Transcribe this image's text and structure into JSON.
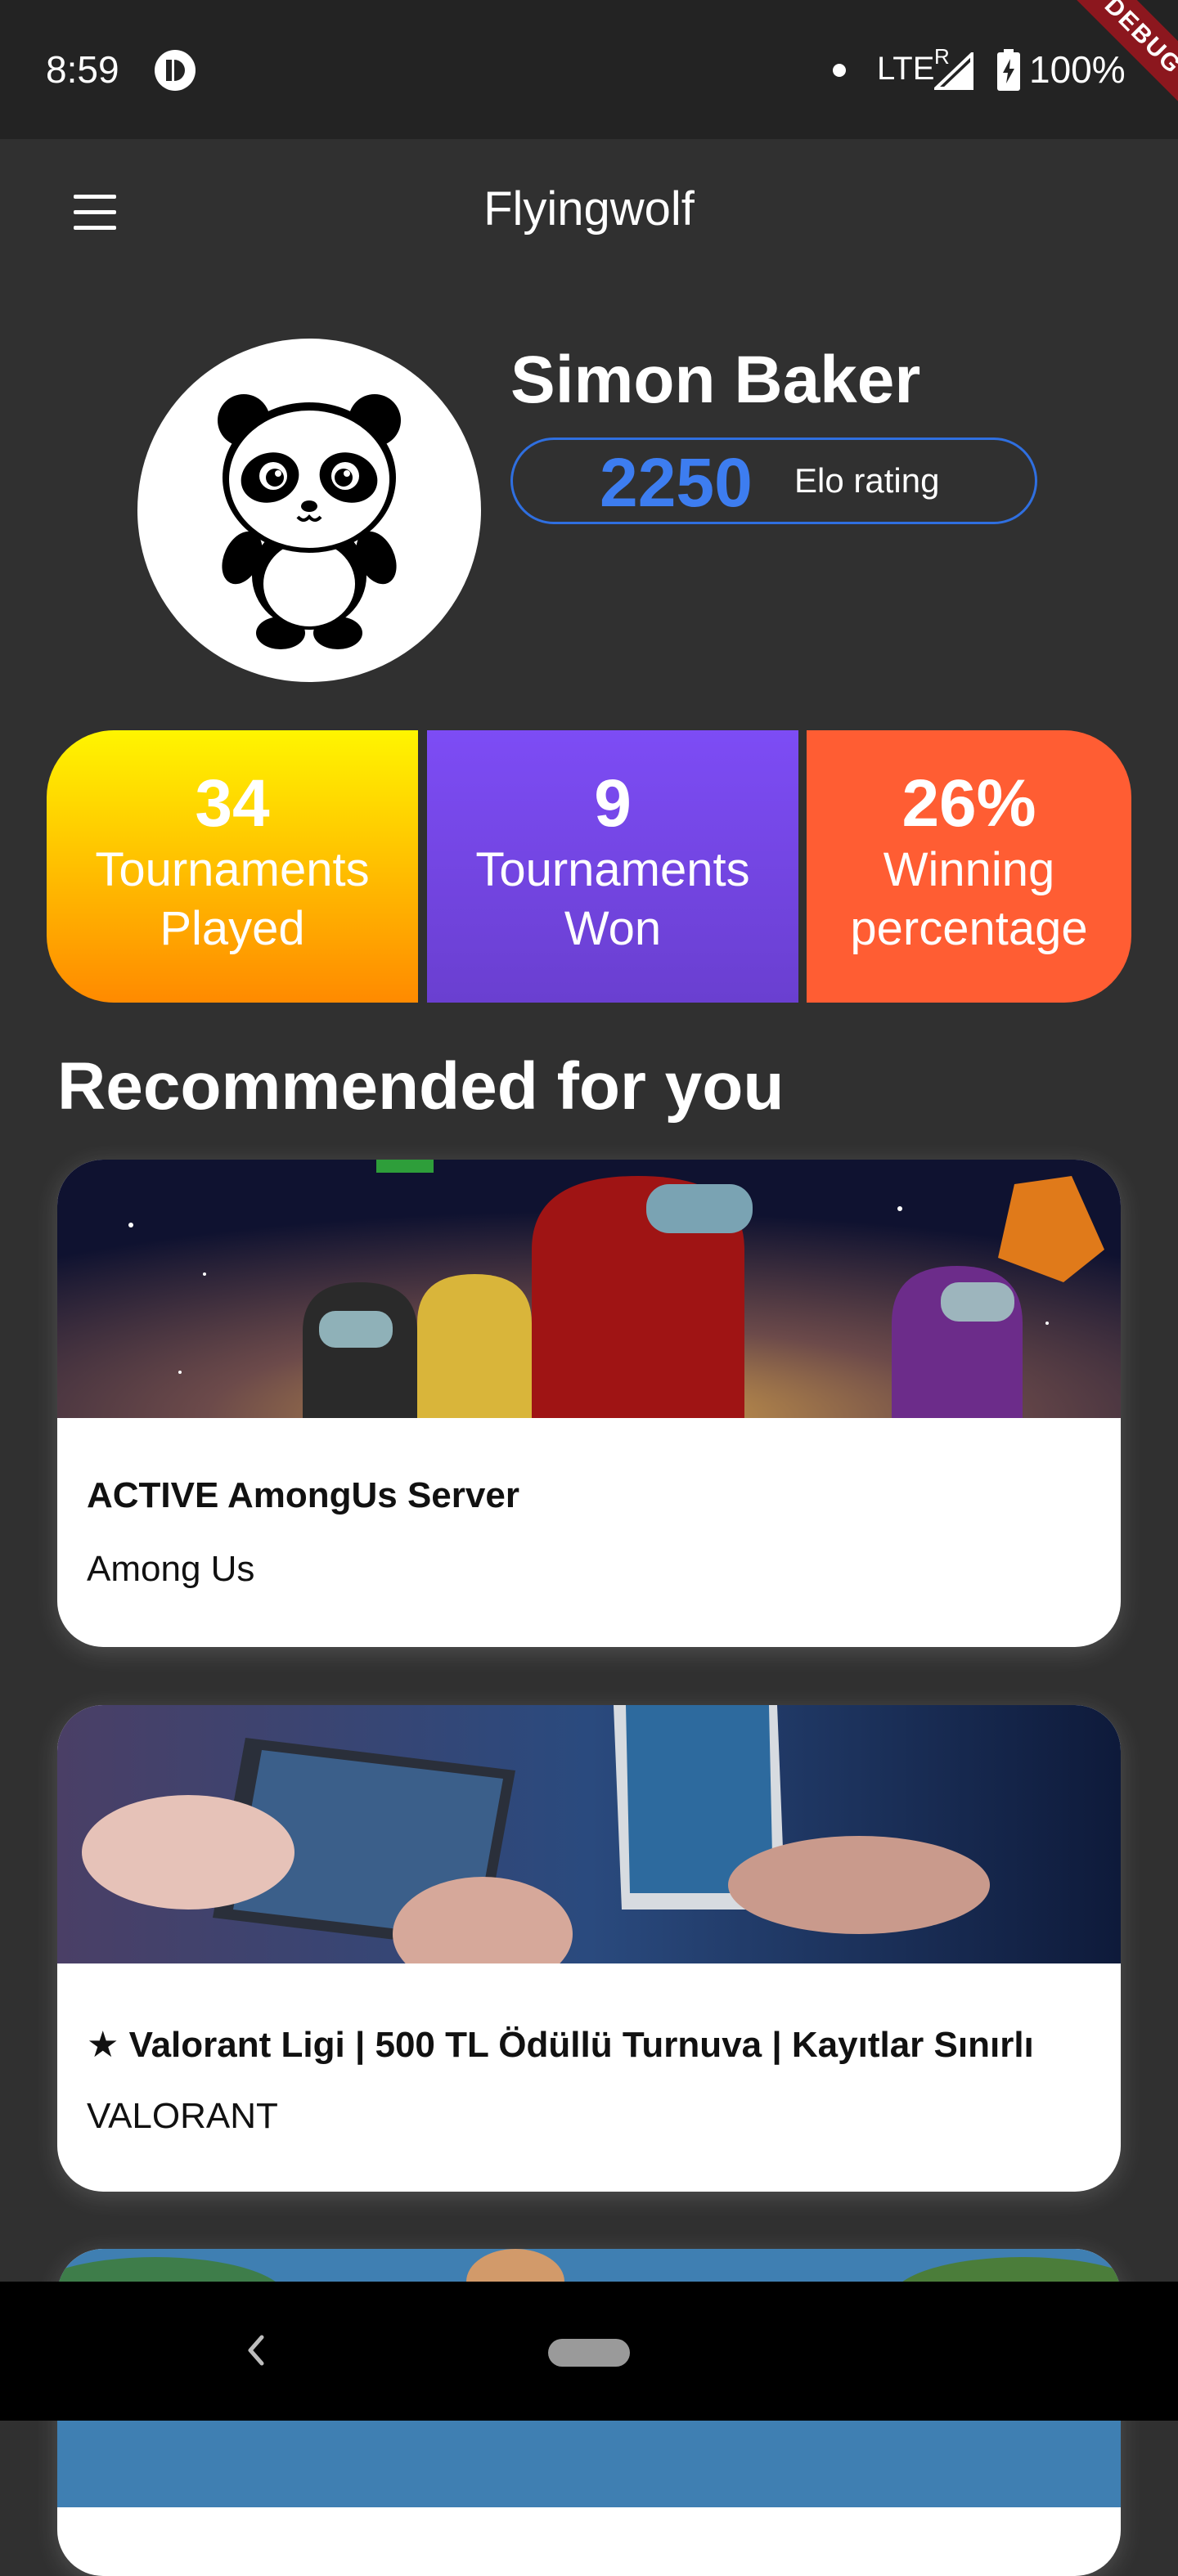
{
  "status_bar": {
    "time": "8:59",
    "network": "LTE",
    "roaming": "R",
    "battery": "100%",
    "debug_banner": "DEBUG"
  },
  "app_bar": {
    "title": "Flyingwolf",
    "menu_icon": "hamburger-menu-icon"
  },
  "profile": {
    "name": "Simon Baker",
    "elo_value": "2250",
    "elo_label": "Elo rating",
    "avatar": "panda-avatar"
  },
  "stats": [
    {
      "value": "34",
      "label_line1": "Tournaments",
      "label_line2": "Played",
      "color_from": "#fff500",
      "color_to": "#ff8a00"
    },
    {
      "value": "9",
      "label_line1": "Tournaments",
      "label_line2": "Won",
      "color_from": "#7d4cf5",
      "color_to": "#6a3fd0"
    },
    {
      "value": "26%",
      "label_line1": "Winning",
      "label_line2": "percentage",
      "color_from": "#ff5d33",
      "color_to": "#ff5d33"
    }
  ],
  "recommended": {
    "section_title": "Recommended for you",
    "cards": [
      {
        "title": "ACTIVE AmongUs Server",
        "game": "Among Us"
      },
      {
        "title": "★ Valorant Ligi | 500 TL Ödüllü Turnuva | Kayıtlar Sınırlı",
        "game": "VALORANT"
      },
      {
        "title": "",
        "game": ""
      }
    ]
  },
  "nav_bar": {
    "back_icon": "back-chevron-icon",
    "home_icon": "home-pill-icon"
  },
  "colors": {
    "background": "#303030",
    "status_bar": "#232323",
    "elo_accent": "#3d7df0"
  }
}
